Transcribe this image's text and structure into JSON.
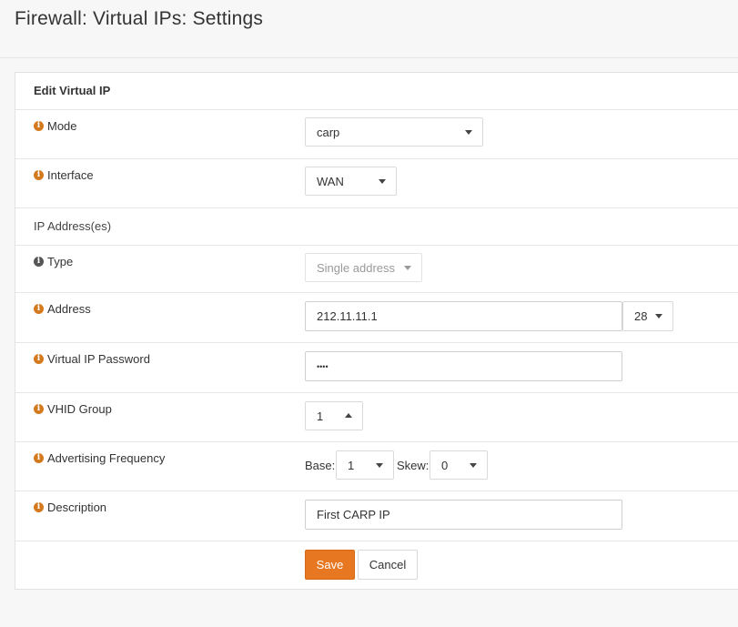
{
  "page": {
    "title": "Firewall: Virtual IPs: Settings"
  },
  "form": {
    "heading": "Edit Virtual IP",
    "mode": {
      "label": "Mode",
      "value": "carp"
    },
    "interface": {
      "label": "Interface",
      "value": "WAN"
    },
    "ip_section": "IP Address(es)",
    "type": {
      "label": "Type",
      "value": "Single address"
    },
    "address": {
      "label": "Address",
      "value": "212.11.11.1",
      "mask": "28"
    },
    "password": {
      "label": "Virtual IP Password",
      "value": "••••"
    },
    "vhid": {
      "label": "VHID Group",
      "value": "1"
    },
    "advfreq": {
      "label": "Advertising Frequency",
      "base_label": "Base:",
      "base_value": "1",
      "skew_label": "Skew:",
      "skew_value": "0"
    },
    "description": {
      "label": "Description",
      "value": "First CARP IP"
    },
    "save_label": "Save",
    "cancel_label": "Cancel"
  },
  "icons": {
    "info": "info-icon",
    "caret": "caret-down-icon"
  },
  "colors": {
    "accent": "#e87722",
    "info_icon": "#d37a1e"
  }
}
